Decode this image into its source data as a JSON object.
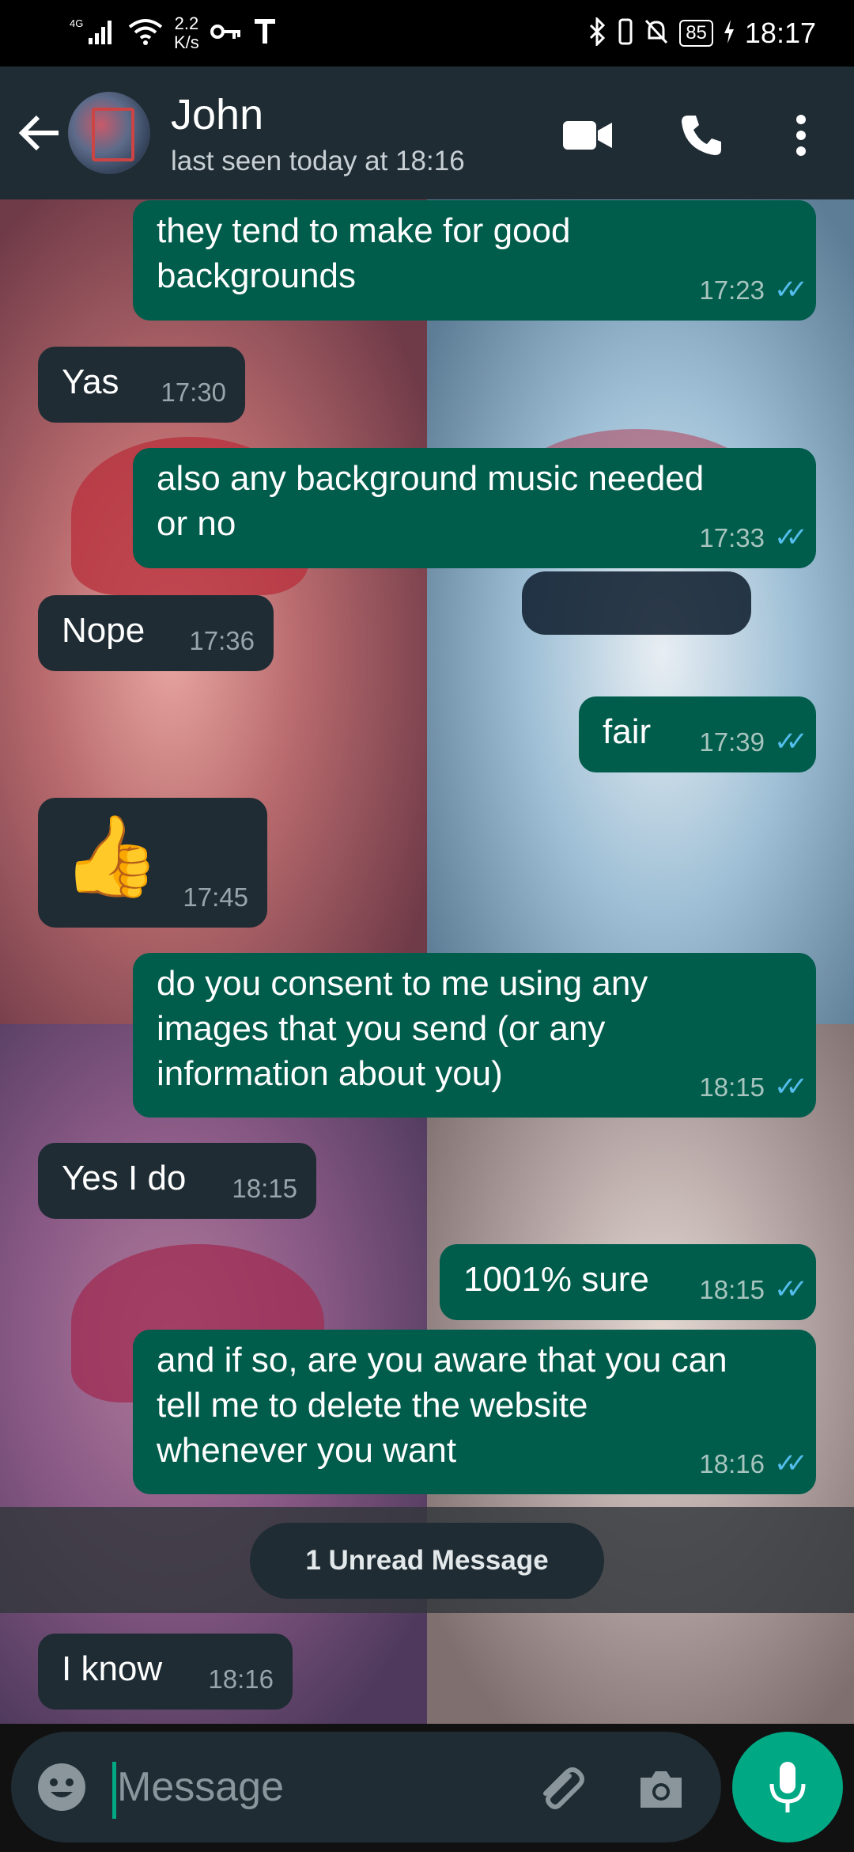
{
  "status_bar": {
    "network": "4G",
    "speed_value": "2.2",
    "speed_unit": "K/s",
    "battery": "85",
    "time": "18:17"
  },
  "header": {
    "name": "John",
    "status": "last seen today at 18:16"
  },
  "messages": [
    {
      "direction": "out",
      "text": "they tend to make for good\nbackgrounds",
      "time": "17:23"
    },
    {
      "direction": "in",
      "text": "Yas",
      "time": "17:30"
    },
    {
      "direction": "out",
      "text": "also any background music needed\nor no",
      "time": "17:33"
    },
    {
      "direction": "in",
      "text": "Nope",
      "time": "17:36"
    },
    {
      "direction": "out",
      "text": "fair",
      "time": "17:39"
    },
    {
      "direction": "in",
      "text": "👍",
      "time": "17:45"
    },
    {
      "direction": "out",
      "text": "do you consent to me using any\nimages that you send (or any\ninformation about you)",
      "time": "18:15"
    },
    {
      "direction": "in",
      "text": "Yes I do",
      "time": "18:15"
    },
    {
      "direction": "out",
      "text": "1001% sure",
      "time": "18:15"
    },
    {
      "direction": "out",
      "text": "and if so, are you aware that you can\ntell me to delete the website\nwhenever you want",
      "time": "18:16"
    },
    {
      "direction": "in",
      "text": "I know",
      "time": "18:16"
    }
  ],
  "unread_label": "1 Unread Message",
  "input": {
    "placeholder": "Message"
  },
  "colors": {
    "outgoing": "#005c4b",
    "incoming": "#1f2c34",
    "accent": "#00a884",
    "ticks": "#53bdeb"
  }
}
